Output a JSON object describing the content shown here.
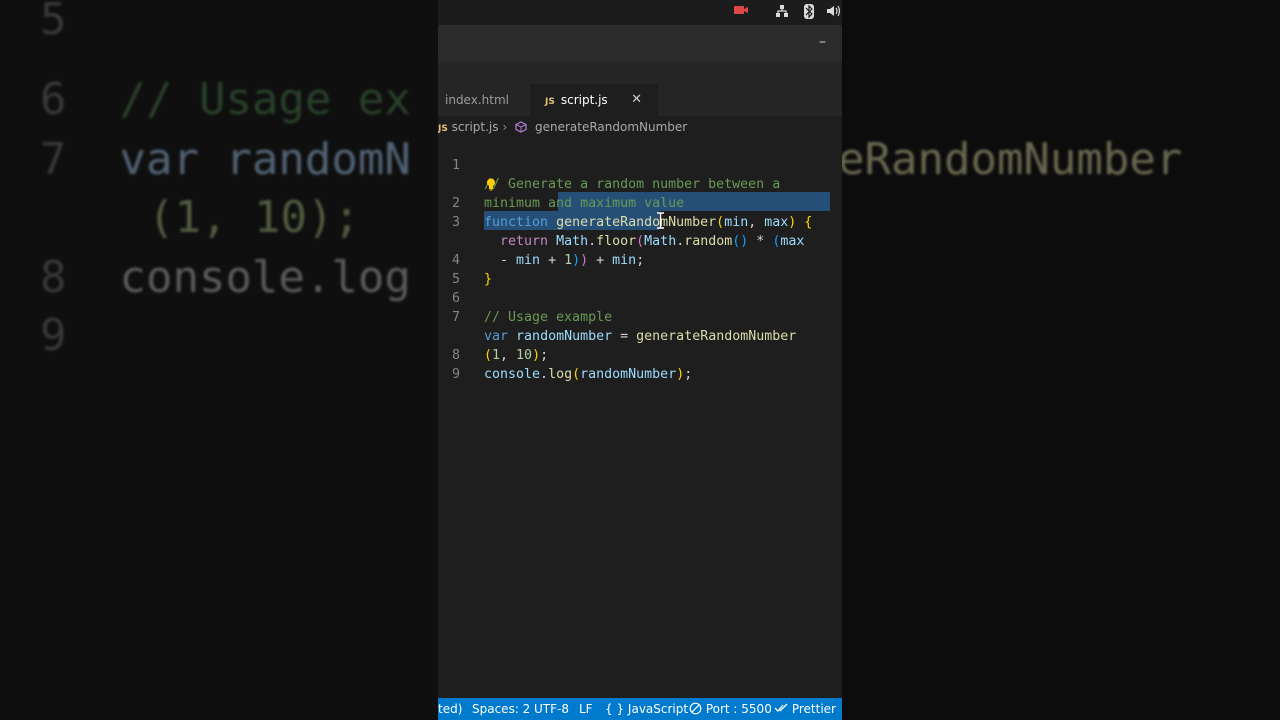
{
  "background_echo": {
    "left_lines": [
      {
        "num": "5",
        "text": ""
      },
      {
        "num": "6",
        "text": "// Usage ex"
      },
      {
        "num": "7",
        "text": "var randomN"
      },
      {
        "num": "",
        "text": "(1, 10);"
      },
      {
        "num": "8",
        "text": "console.log"
      },
      {
        "num": "9",
        "text": ""
      }
    ],
    "right_fragment": "eRandomNumber"
  },
  "editor": {
    "tabs": [
      {
        "label": "index.html",
        "active": false
      },
      {
        "label": "script.js",
        "active": true,
        "badge": "JS",
        "close": "✕"
      }
    ],
    "breadcrumb": {
      "file_badge": "JS",
      "file": "script.js",
      "separator": "›",
      "symbol": "generateRandomNumber"
    },
    "lines": [
      {
        "num": "1",
        "segments": [
          "// Generate a random number between a"
        ]
      },
      {
        "num": "",
        "segments": [
          "minimum and maximum value"
        ]
      },
      {
        "num": "2",
        "segments": [
          "function",
          " ",
          "generateRandomNumber",
          "(",
          "min",
          ", ",
          "max",
          ") ",
          "{"
        ]
      },
      {
        "num": "3",
        "segments": [
          "  ",
          "return",
          " ",
          "Math",
          ".",
          "floor",
          "(",
          "Math",
          ".",
          "random",
          "()",
          " * ",
          "(",
          "max"
        ]
      },
      {
        "num": "",
        "segments": [
          "  - ",
          "min",
          " + ",
          "1",
          ")",
          ")",
          " + ",
          "min",
          ";"
        ]
      },
      {
        "num": "4",
        "segments": [
          "}"
        ]
      },
      {
        "num": "5",
        "segments": [
          ""
        ]
      },
      {
        "num": "6",
        "segments": [
          "// Usage example"
        ]
      },
      {
        "num": "7",
        "segments": [
          "var",
          " ",
          "randomNumber",
          " = ",
          "generateRandomNumber"
        ]
      },
      {
        "num": "",
        "segments": [
          "(",
          "1",
          ", ",
          "10",
          ")",
          ";"
        ]
      },
      {
        "num": "8",
        "segments": [
          "console",
          ".",
          "log",
          "(",
          "randomNumber",
          ")",
          ";"
        ]
      },
      {
        "num": "9",
        "segments": [
          ""
        ]
      }
    ]
  },
  "statusbar": {
    "selection_fragment": "ted)",
    "spaces": "Spaces: 2",
    "encoding": "UTF-8",
    "eol": "LF",
    "language_icon": "{ }",
    "language": "JavaScript",
    "port": "Port : 5500",
    "formatter": "Prettier"
  },
  "colors": {
    "editor_bg": "#1e1e1e",
    "selection": "#264f78",
    "statusbar": "#007acc",
    "comment": "#6a9955",
    "keyword": "#569cd6",
    "function": "#dcdcaa",
    "variable": "#9cdcfe",
    "number": "#b5cea8"
  },
  "icons": [
    "record-icon",
    "network-icon",
    "bluetooth-icon",
    "volume-icon",
    "minimize-icon",
    "lightbulb-icon",
    "symbol-method-icon",
    "port-icon",
    "double-check-icon",
    "text-cursor-icon"
  ]
}
